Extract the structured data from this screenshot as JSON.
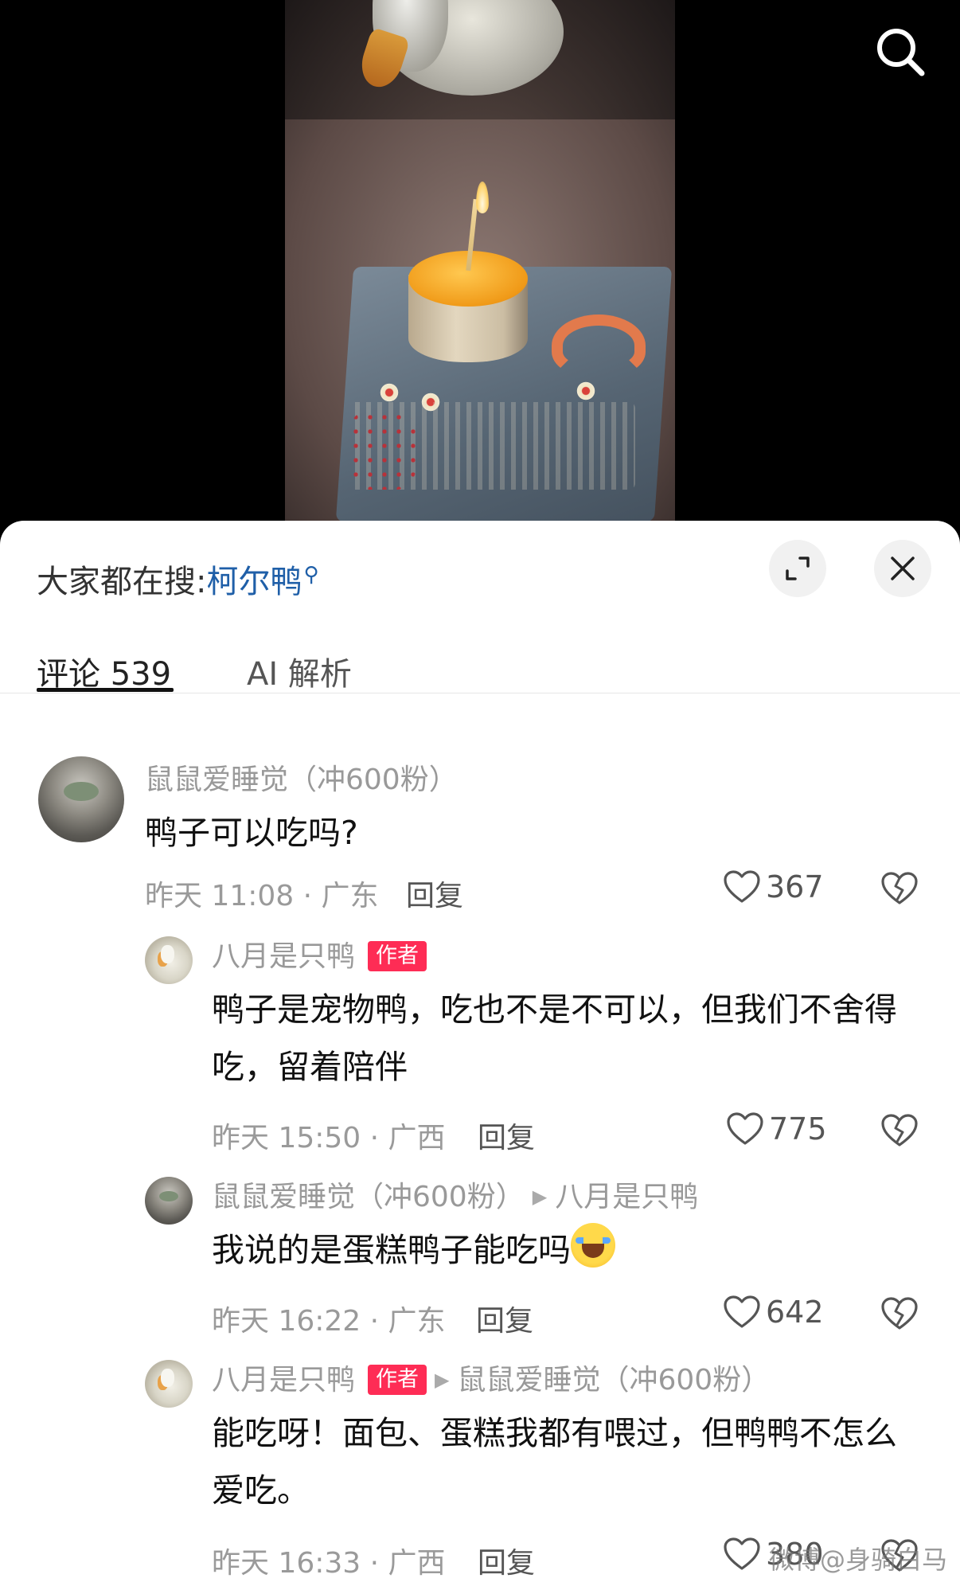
{
  "hot_search": {
    "prefix": "大家都在搜:",
    "keyword": "柯尔鸭"
  },
  "tabs": [
    {
      "label": "评论 539"
    },
    {
      "label": "AI 解析"
    }
  ],
  "comments": [
    {
      "user": "鼠鼠爱睡觉（冲600粉）",
      "text": "鸭子可以吃吗?",
      "meta": "昨天 11:08 · 广东",
      "reply_label": "回复",
      "likes": "367"
    },
    {
      "user": "八月是只鸭",
      "badge": "作者",
      "text": "鸭子是宠物鸭，吃也不是不可以，但我们不舍得吃，留着陪伴",
      "meta": "昨天 15:50 · 广西",
      "reply_label": "回复",
      "likes": "775"
    },
    {
      "user": "鼠鼠爱睡觉（冲600粉）",
      "reply_to": "八月是只鸭",
      "text": "我说的是蛋糕鸭子能吃吗",
      "meta": "昨天 16:22 · 广东",
      "reply_label": "回复",
      "likes": "642"
    },
    {
      "user": "八月是只鸭",
      "badge": "作者",
      "reply_to": "鼠鼠爱睡觉（冲600粉）",
      "text": "能吃呀！面包、蛋糕我都有喂过，但鸭鸭不怎么爱吃。",
      "meta": "昨天 16:33 · 广西",
      "reply_label": "回复",
      "likes": "380"
    }
  ],
  "watermark": "微博@身骑白马",
  "icons": {
    "search": "search-icon",
    "expand": "expand-icon",
    "close": "close-icon",
    "like": "heart-icon",
    "dislike": "broken-heart-icon"
  }
}
